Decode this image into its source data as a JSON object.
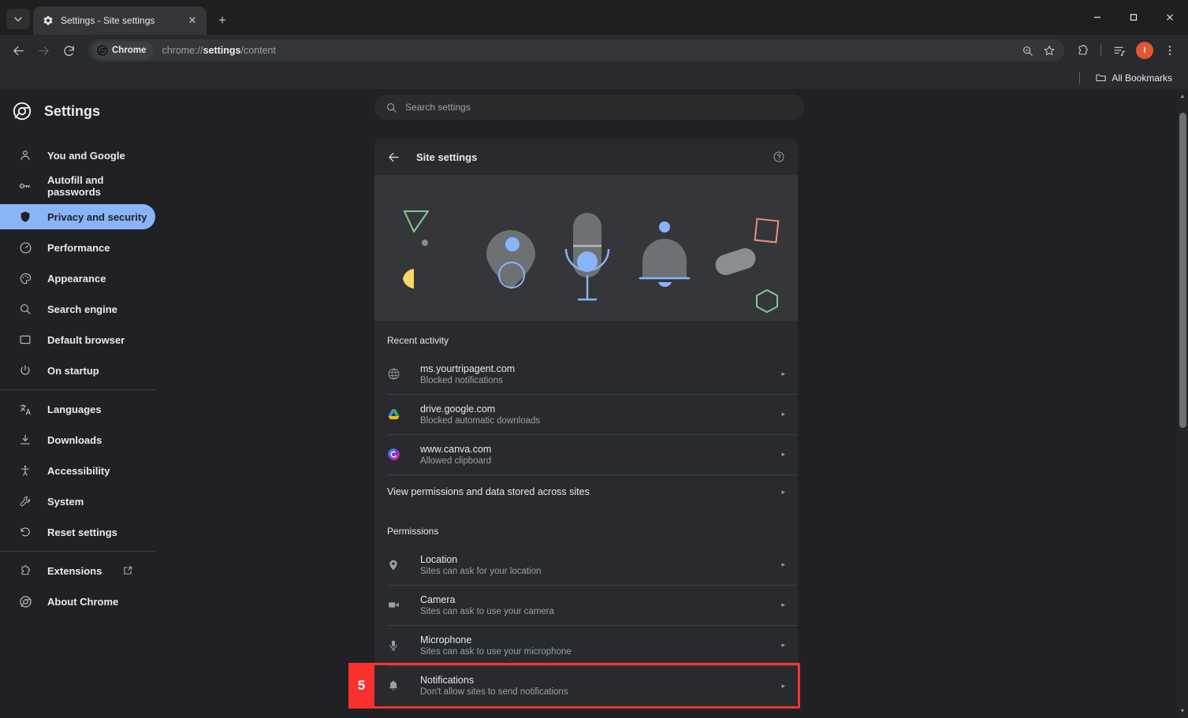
{
  "window": {
    "minimize_label": "–",
    "maximize_label": "❑",
    "close_label": "✕"
  },
  "tabstrip": {
    "tab_search_icon": "chevron-down-icon",
    "tabs": [
      {
        "title": "Settings - Site settings",
        "favicon": "gear-icon",
        "close_label": "✕"
      }
    ],
    "new_tab_label": "+"
  },
  "toolbar": {
    "back_icon": "arrow-left-icon",
    "forward_icon": "arrow-right-icon",
    "reload_icon": "reload-icon",
    "chip_label": "Chrome",
    "url_prefix": "chrome://",
    "url_bold": "settings",
    "url_suffix": "/content",
    "zoom_icon": "search-minus-icon",
    "bookmark_icon": "star-icon",
    "extensions_icon": "puzzle-icon",
    "reading_list_icon": "reading-list-icon",
    "profile_initial": "I",
    "menu_icon": "kebab-menu-icon"
  },
  "bookmarkbar": {
    "all_bookmarks_label": "All Bookmarks",
    "folder_icon": "folder-icon"
  },
  "sidebar": {
    "logo": "chrome-logo-icon",
    "title": "Settings",
    "items": [
      {
        "label": "You and Google",
        "icon": "person-icon",
        "active": false
      },
      {
        "label": "Autofill and passwords",
        "icon": "key-icon",
        "active": false
      },
      {
        "label": "Privacy and security",
        "icon": "shield-icon",
        "active": true
      },
      {
        "label": "Performance",
        "icon": "speedometer-icon",
        "active": false
      },
      {
        "label": "Appearance",
        "icon": "palette-icon",
        "active": false
      },
      {
        "label": "Search engine",
        "icon": "search-icon",
        "active": false
      },
      {
        "label": "Default browser",
        "icon": "window-icon",
        "active": false
      },
      {
        "label": "On startup",
        "icon": "power-icon",
        "active": false
      }
    ],
    "items_group2": [
      {
        "label": "Languages",
        "icon": "translate-icon"
      },
      {
        "label": "Downloads",
        "icon": "download-icon"
      },
      {
        "label": "Accessibility",
        "icon": "accessibility-icon"
      },
      {
        "label": "System",
        "icon": "wrench-icon"
      },
      {
        "label": "Reset settings",
        "icon": "restore-icon"
      }
    ],
    "items_group3": [
      {
        "label": "Extensions",
        "icon": "extension-icon",
        "external": true
      },
      {
        "label": "About Chrome",
        "icon": "chrome-logo-icon",
        "external": false
      }
    ]
  },
  "search": {
    "placeholder": "Search settings",
    "icon": "search-icon"
  },
  "content": {
    "header": {
      "back_icon": "arrow-left-icon",
      "title": "Site settings",
      "help_icon": "help-circle-icon"
    },
    "hero_alt": "site-settings-illustration",
    "recent_activity": {
      "label": "Recent activity",
      "rows": [
        {
          "site": "ms.yourtripagent.com",
          "status": "Blocked notifications",
          "favicon": "globe-icon",
          "chevron": "▸"
        },
        {
          "site": "drive.google.com",
          "status": "Blocked automatic downloads",
          "favicon": "google-drive-icon",
          "chevron": "▸"
        },
        {
          "site": "www.canva.com",
          "status": "Allowed clipboard",
          "favicon": "canva-icon",
          "chevron": "▸"
        }
      ],
      "view_all": {
        "title": "View permissions and data stored across sites",
        "chevron": "▸"
      }
    },
    "permissions": {
      "label": "Permissions",
      "rows": [
        {
          "title": "Location",
          "sub": "Sites can ask for your location",
          "icon": "location-pin-icon",
          "chevron": "▸",
          "highlighted": false
        },
        {
          "title": "Camera",
          "sub": "Sites can ask to use your camera",
          "icon": "camera-icon",
          "chevron": "▸",
          "highlighted": false
        },
        {
          "title": "Microphone",
          "sub": "Sites can ask to use your microphone",
          "icon": "microphone-icon",
          "chevron": "▸",
          "highlighted": false
        },
        {
          "title": "Notifications",
          "sub": "Don't allow sites to send notifications",
          "icon": "bell-icon",
          "chevron": "▸",
          "highlighted": true
        }
      ]
    }
  },
  "annotation": {
    "step_number": "5",
    "highlight_color": "#f8312f"
  },
  "colors": {
    "page_bg": "#202124",
    "card_bg": "#292a2d",
    "toolbar_bg": "#292a2d",
    "tabstrip_bg": "#1f1f1f",
    "accent_blue": "#8ab4f8",
    "text_primary": "#e8eaed",
    "text_secondary": "#9aa0a6",
    "divider": "#3c4043",
    "hero_bg": "#35363a",
    "profile_orange": "#e8542f"
  }
}
